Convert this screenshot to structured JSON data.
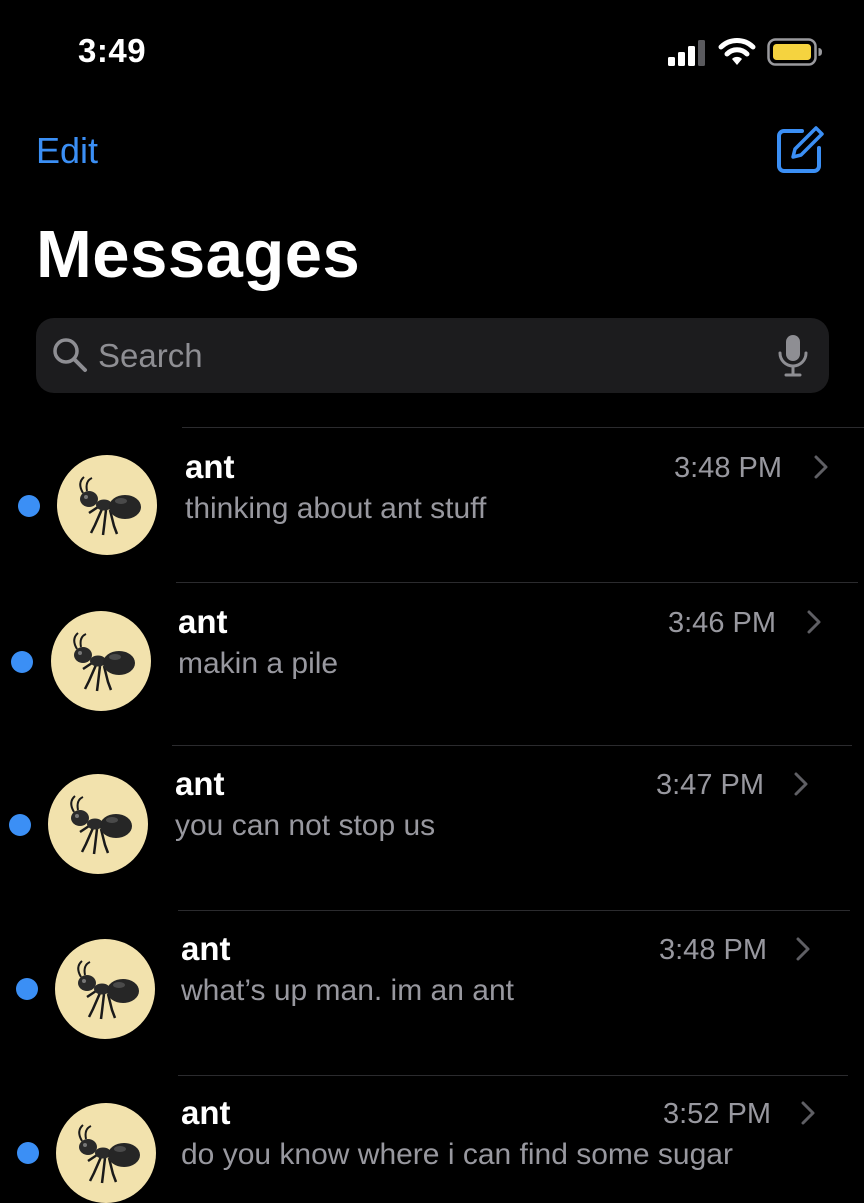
{
  "status_bar": {
    "time": "3:49"
  },
  "header": {
    "edit_label": "Edit",
    "title": "Messages"
  },
  "search": {
    "placeholder": "Search"
  },
  "colors": {
    "accent": "#3b8ff5",
    "background": "#000000",
    "search_bg": "#1c1c1e",
    "secondary_text": "#98989f",
    "avatar_bg": "#f2e2ad",
    "battery": "#f5d33f"
  },
  "conversations": [
    {
      "name": "ant",
      "preview": "thinking about ant stuff",
      "time": "3:48 PM",
      "unread": true,
      "avatar_icon": "ant-icon"
    },
    {
      "name": "ant",
      "preview": "makin a pile",
      "time": "3:46 PM",
      "unread": true,
      "avatar_icon": "ant-icon"
    },
    {
      "name": "ant",
      "preview": "you can not stop us",
      "time": "3:47 PM",
      "unread": true,
      "avatar_icon": "ant-icon"
    },
    {
      "name": "ant",
      "preview": "what’s up man. im an ant",
      "time": "3:48 PM",
      "unread": true,
      "avatar_icon": "ant-icon"
    },
    {
      "name": "ant",
      "preview": "do you know where i can find some sugar",
      "time": "3:52 PM",
      "unread": true,
      "avatar_icon": "ant-icon"
    }
  ]
}
